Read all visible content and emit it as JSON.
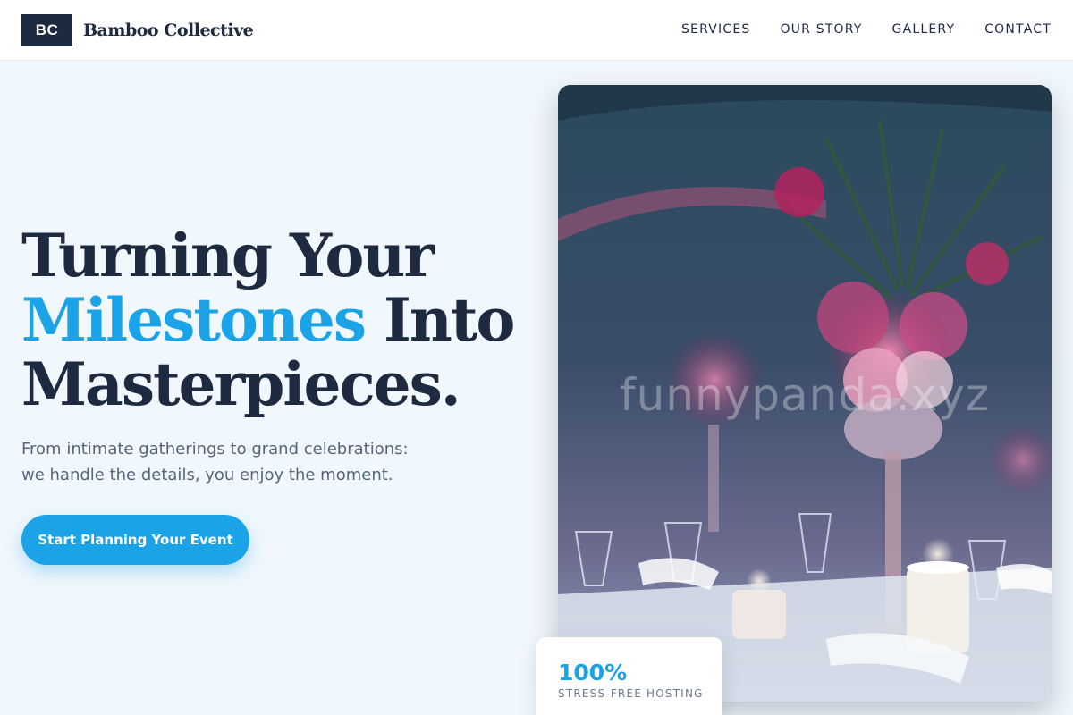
{
  "header": {
    "logo_mark": "BC",
    "brand_name": "Bamboo Collective",
    "nav": [
      {
        "label": "SERVICES"
      },
      {
        "label": "OUR STORY"
      },
      {
        "label": "GALLERY"
      },
      {
        "label": "CONTACT"
      }
    ]
  },
  "hero": {
    "headline_line1": "Turning Your",
    "headline_accent": "Milestones",
    "headline_line2_rest": " Into",
    "headline_line3": "Masterpieces.",
    "subtext": "From intimate gatherings to grand celebrations: we handle the details, you enjoy the moment.",
    "cta_label": "Start Planning Your Event",
    "image_watermark": "funnypanda.xyz"
  },
  "stat": {
    "value": "100%",
    "label": "STRESS-FREE HOSTING"
  },
  "colors": {
    "brand_dark": "#1e2a40",
    "accent": "#1aa3e6",
    "page_background": "#f0f7fd"
  }
}
